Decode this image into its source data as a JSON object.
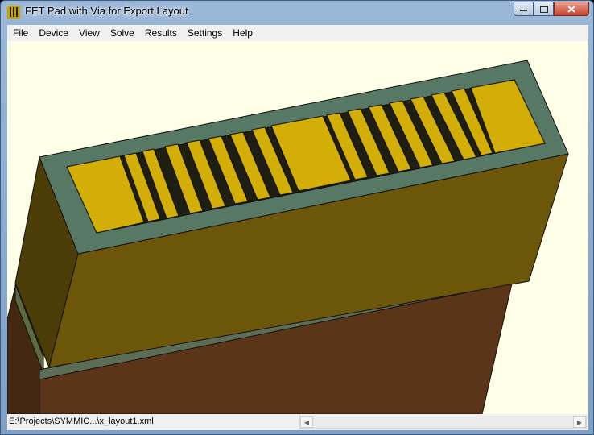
{
  "window": {
    "title": "FET Pad with Via for Export Layout",
    "app_icon": "fet-app-icon",
    "controls": [
      "minimize-icon",
      "maximize-icon",
      "close-icon"
    ]
  },
  "menu": {
    "items": [
      "File",
      "Device",
      "View",
      "Solve",
      "Results",
      "Settings",
      "Help"
    ]
  },
  "colors": {
    "viewport_bg": "#ffffe8",
    "die_top_frame": "#567864",
    "pad_gold": "#d2ae06",
    "die_front": "#6b560a",
    "die_side": "#4c3d08",
    "substrate_front": "#5a3518",
    "substrate_side": "#43280f"
  },
  "status": {
    "path": "E:\\Projects\\SYMMIC...\\x_layout1.xml"
  }
}
